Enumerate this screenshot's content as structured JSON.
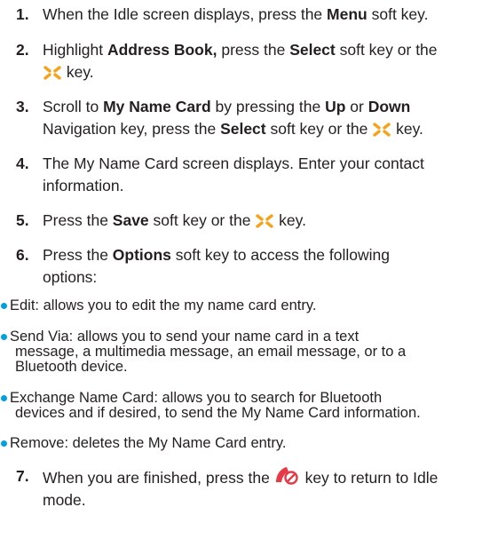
{
  "steps": [
    {
      "num": "1.",
      "t0": "When the Idle screen displays, press the ",
      "b1": "Menu",
      "t1": " soft key."
    },
    {
      "num": "2.",
      "t0": "Highlight ",
      "b1": "Address Book,",
      "t1": " press the ",
      "b2": "Select",
      "t2": " soft key or the",
      "t3": " key."
    },
    {
      "num": "3.",
      "t0": "Scroll to ",
      "b1": "My Name Card",
      "t1": " by pressing the ",
      "b2": "Up",
      "t2": " or ",
      "b3": "Down",
      "t3": "Navigation key, press the ",
      "b4": "Select",
      "t4": " soft key or the ",
      "t5": " key."
    },
    {
      "num": "4.",
      "t0": "The My Name Card screen displays. Enter your contact",
      "t1": "information."
    },
    {
      "num": "5.",
      "t0": "Press the ",
      "b1": "Save",
      "t1": " soft key or the ",
      "t2": " key."
    },
    {
      "num": "6.",
      "t0": "Press the ",
      "b1": "Options",
      "t1": " soft key to access the following",
      "t2": "options:"
    },
    {
      "num": "7.",
      "t0": "When you are finished, press the ",
      "t1": " key to return to Idle",
      "t2": "mode."
    }
  ],
  "options": [
    {
      "lines": [
        "Edit: allows you to edit the my name card entry."
      ]
    },
    {
      "lines": [
        "Send Via: allows you to send your name card in a text",
        "message, a multimedia message, an email message, or to a",
        "Bluetooth device."
      ]
    },
    {
      "lines": [
        "Exchange Name Card: allows you to search for Bluetooth",
        "devices and if desired, to send the My Name Card information."
      ]
    },
    {
      "lines": [
        "Remove: deletes the My Name Card entry."
      ]
    }
  ],
  "icons": {
    "select_key": "navigation-select-key-icon",
    "end_key": "end-call-key-icon"
  },
  "colors": {
    "text": "#231f20",
    "bullet": "#00a0e0",
    "select_icon": "#f7a21b",
    "end_icon": "#e63a46"
  }
}
